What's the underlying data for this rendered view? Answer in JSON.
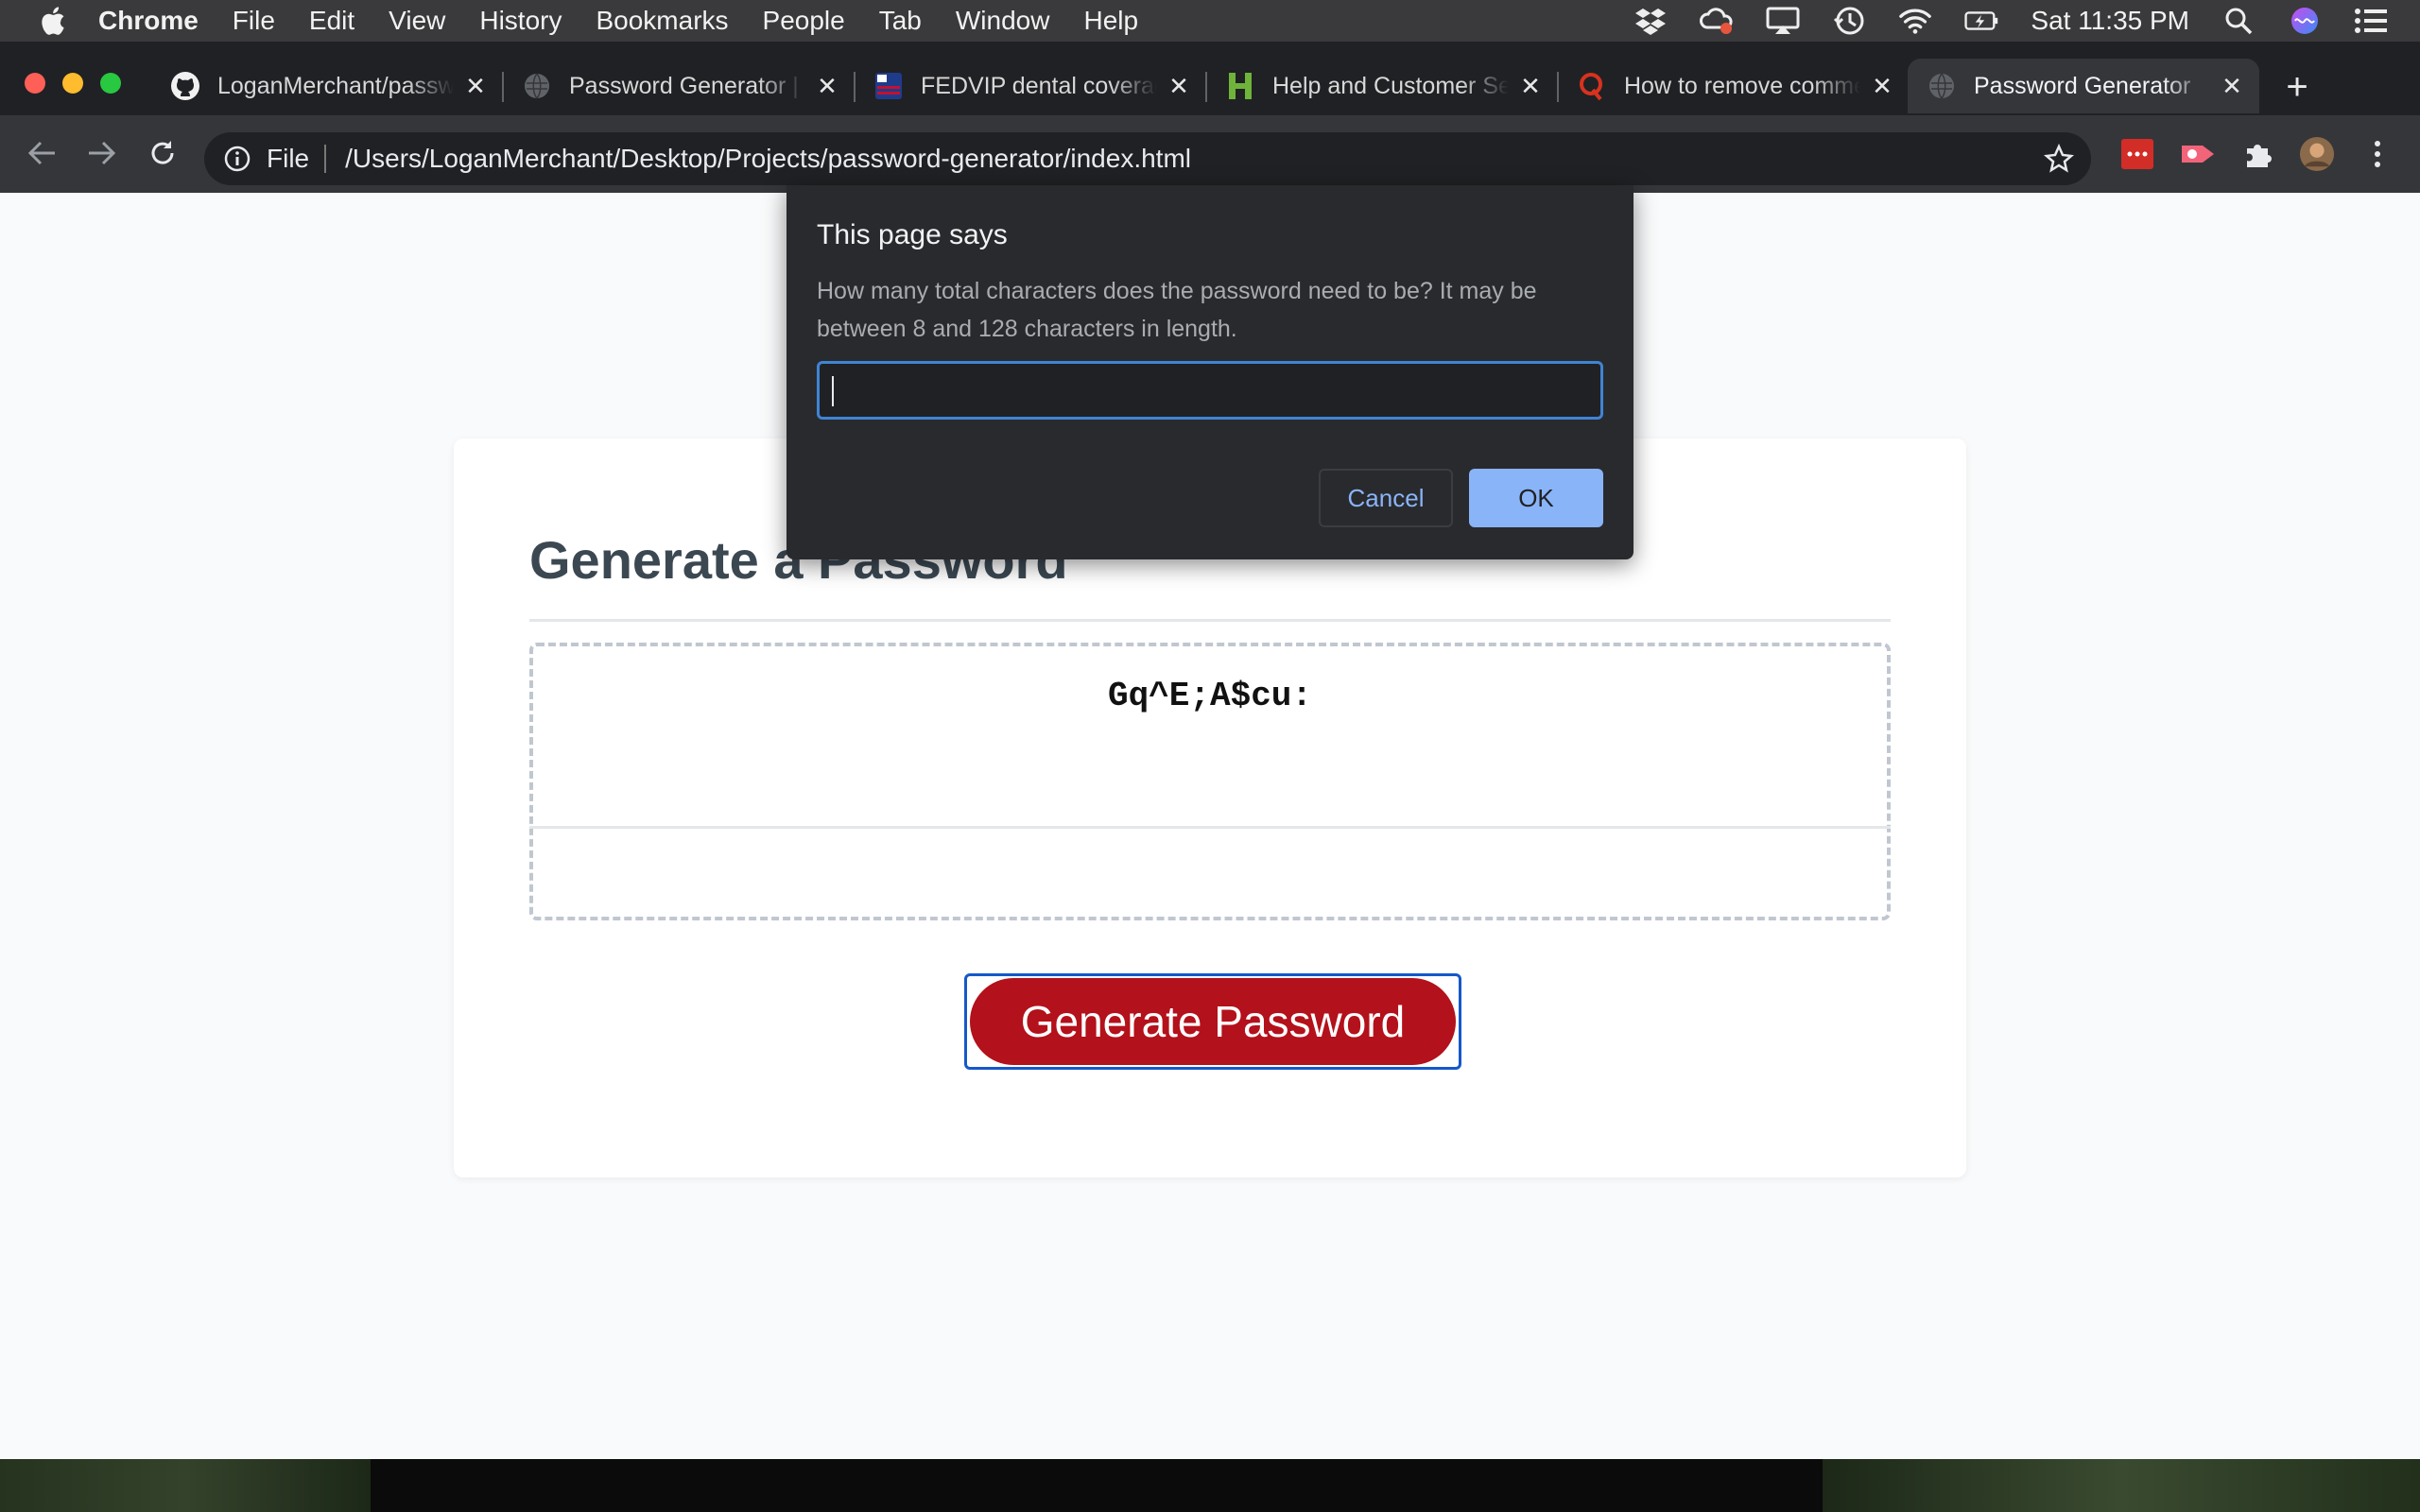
{
  "menubar": {
    "app": "Chrome",
    "items": [
      "File",
      "Edit",
      "View",
      "History",
      "Bookmarks",
      "People",
      "Tab",
      "Window",
      "Help"
    ],
    "clock": "Sat 11:35 PM",
    "status_icons": [
      "dropbox-icon",
      "creative-cloud-icon",
      "airplay-icon",
      "time-machine-icon",
      "wifi-icon",
      "battery-icon"
    ]
  },
  "tabs": [
    {
      "title": "LoganMerchant/password-generator",
      "favicon": "github-icon",
      "active": false
    },
    {
      "title": "Password Generator | LoganMerchant",
      "favicon": "globe-icon",
      "active": false
    },
    {
      "title": "FEDVIP dental coverage",
      "favicon": "fedvip-icon",
      "active": false
    },
    {
      "title": "Help and Customer Service",
      "favicon": "h-icon",
      "active": false
    },
    {
      "title": "How to remove comments",
      "favicon": "quora-icon",
      "active": false
    },
    {
      "title": "Password Generator",
      "favicon": "globe-icon",
      "active": true
    }
  ],
  "toolbar": {
    "scheme": "File",
    "url": "/Users/LoganMerchant/Desktop/Projects/password-generator/index.html"
  },
  "page": {
    "heading": "Generate a Password",
    "password": "Gq^E;A$cu:",
    "generate_button": "Generate Password"
  },
  "dialog": {
    "title": "This page says",
    "message": "How many total characters does the password need to be? It may be between 8 and 128 characters in length.",
    "input_value": "",
    "cancel_label": "Cancel",
    "ok_label": "OK"
  },
  "colors": {
    "button_red": "#b3111b",
    "focus_blue": "#1558c9",
    "dialog_bg": "#292a2d",
    "ok_blue": "#8ab4f8"
  }
}
